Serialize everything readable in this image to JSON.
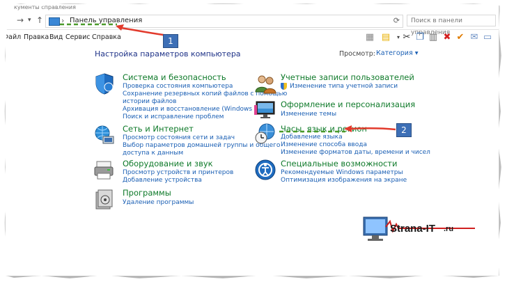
{
  "window": {
    "clipped_title": "кументы справления",
    "address_path": "Панель управления",
    "search_placeholder": "Поиск в панели управления"
  },
  "menu": [
    "Файл",
    "Правка",
    "Вид",
    "Сервис",
    "Справка"
  ],
  "heading": "Настройка параметров компьютера",
  "view_by": {
    "label": "Просмотр:",
    "value": "Категория"
  },
  "categories_left": [
    {
      "title": "Система и безопасность",
      "icon": "shield-icon",
      "links": [
        "Проверка состояния компьютера",
        "Сохранение резервных копий файлов с помощью",
        "истории файлов",
        "Архивация и восстановление (Windows 7)",
        "Поиск и исправление проблем"
      ]
    },
    {
      "title": "Сеть и Интернет",
      "icon": "network-globe-icon",
      "links": [
        "Просмотр состояния сети и задач",
        "Выбор параметров домашней группы и общего",
        "доступа к данным"
      ]
    },
    {
      "title": "Оборудование и звук",
      "icon": "printer-icon",
      "links": [
        "Просмотр устройств и принтеров",
        "Добавление устройства"
      ]
    },
    {
      "title": "Программы",
      "icon": "programs-icon",
      "links": [
        "Удаление программы"
      ]
    }
  ],
  "categories_right": [
    {
      "title": "Учетные записи пользователей",
      "icon": "users-icon",
      "links": [
        "Изменение типа учетной записи"
      ]
    },
    {
      "title": "Оформление и персонализация",
      "icon": "monitor-icon",
      "links": [
        "Изменение темы"
      ]
    },
    {
      "title": "Часы, язык и регион",
      "icon": "clock-globe-icon",
      "links": [
        "Добавление языка",
        "Изменение способа ввода",
        "Изменение форматов даты, времени и чисел"
      ]
    },
    {
      "title": "Специальные возможности",
      "icon": "accessibility-icon",
      "links": [
        "Рекомендуемые Windows параметры",
        "Оптимизация изображения на экране"
      ]
    }
  ],
  "annotations": {
    "badge_1": "1",
    "badge_2": "2"
  },
  "watermark": {
    "brand": "Strana-IT",
    "suffix": ".ru"
  },
  "colors": {
    "category_title": "#0f7a2a",
    "link": "#1a5fb4",
    "heading": "#1e3287",
    "arrow": "#e23a2c",
    "dash_green": "#4a9a2a",
    "badge": "#3d6fb6"
  }
}
